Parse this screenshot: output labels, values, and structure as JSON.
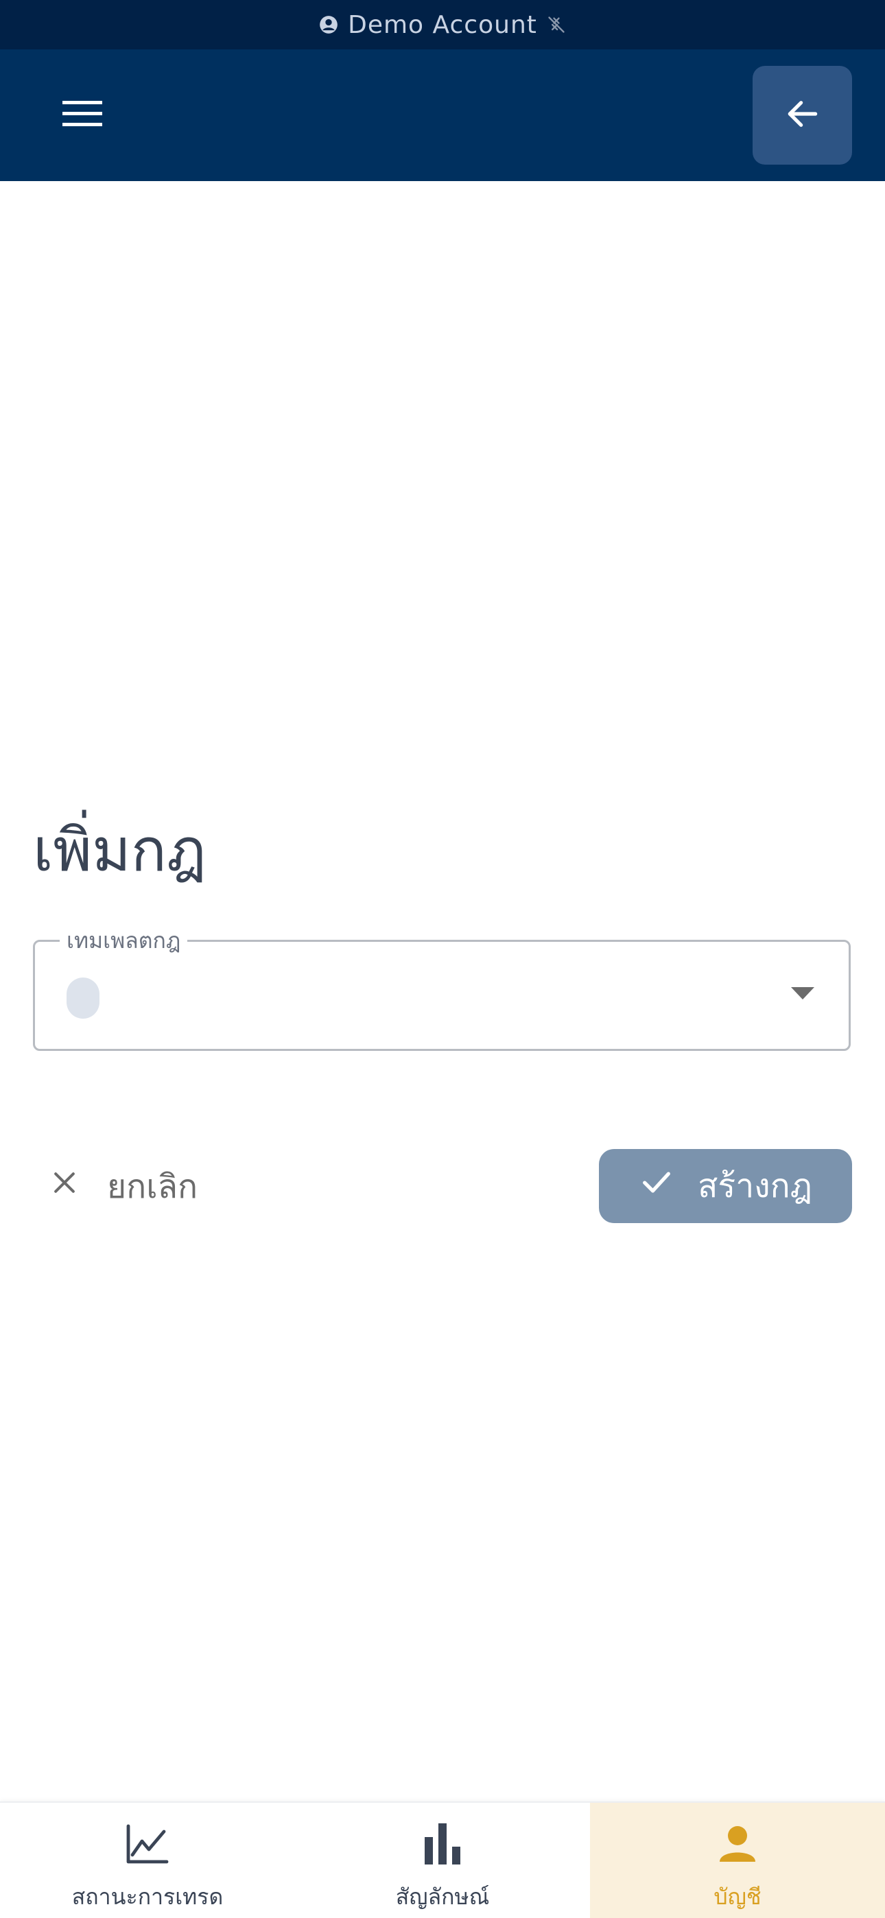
{
  "banner": {
    "account_label": "Demo Account",
    "account_icon": "account-circle-icon",
    "status_icon": "sync-disabled-icon"
  },
  "app_bar": {
    "menu_icon": "hamburger-menu-icon",
    "back_icon": "arrow-left-icon"
  },
  "page": {
    "title": "เพิ่มกฎ"
  },
  "form": {
    "template_field": {
      "label": "เทมเพลตกฎ",
      "value": ""
    }
  },
  "actions": {
    "cancel_label": "ยกเลิก",
    "create_label": "สร้างกฎ"
  },
  "bottom_nav": {
    "items": [
      {
        "label": "สถานะการเทรด",
        "icon": "line-chart-icon",
        "active": false
      },
      {
        "label": "สัญลักษณ์",
        "icon": "bar-chart-icon",
        "active": false
      },
      {
        "label": "บัญชี",
        "icon": "person-icon",
        "active": true
      }
    ]
  },
  "colors": {
    "banner_bg": "#012147",
    "app_bar_bg": "#00305f",
    "accent": "#d9a021",
    "create_button_bg": "#7b93ad",
    "active_nav_bg": "#faf0dc"
  }
}
